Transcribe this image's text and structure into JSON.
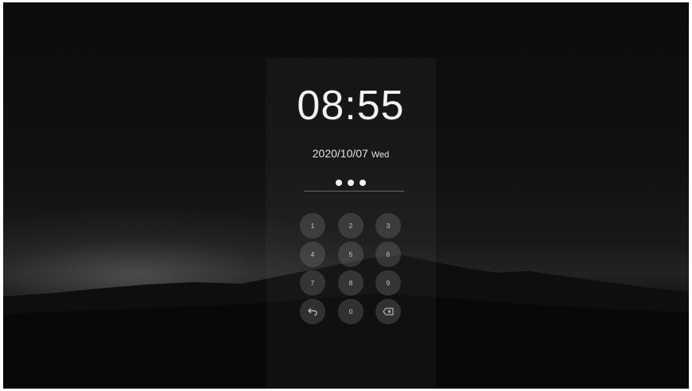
{
  "lock_screen": {
    "time": "08:55",
    "date": "2020/10/07",
    "weekday": "Wed",
    "pin_entered_count": 3
  },
  "keypad": {
    "keys": [
      "1",
      "2",
      "3",
      "4",
      "5",
      "6",
      "7",
      "8",
      "9",
      "0"
    ],
    "back_icon": "back-arrow-icon",
    "delete_icon": "backspace-icon"
  }
}
